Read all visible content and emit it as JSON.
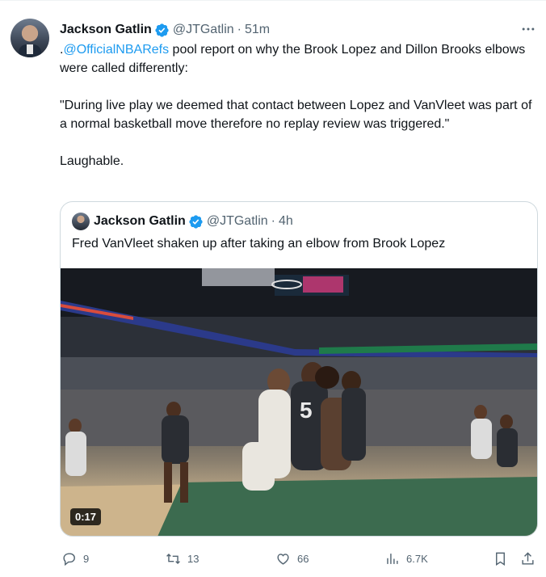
{
  "tweet": {
    "author_name": "Jackson Gatlin",
    "handle": "@JTGatlin",
    "separator": "·",
    "time": "51m",
    "more_icon": "more-icon",
    "text_mention": "@OfficialNBARefs",
    "text_lead": ".",
    "text_rest": " pool report on why the Brook Lopez and Dillon Brooks elbows were called differently:",
    "quote_text": "\"During live play we deemed  that contact between Lopez and VanVleet was part of a normal basketball move therefore no replay review was triggered.\"",
    "closing": "Laughable."
  },
  "quoted": {
    "author_name": "Jackson Gatlin",
    "handle": "@JTGatlin",
    "separator": "·",
    "time": "4h",
    "text": "Fred VanVleet shaken up after taking an elbow from Brook Lopez",
    "video_duration": "0:17"
  },
  "actions": {
    "reply_count": "9",
    "retweet_count": "13",
    "like_count": "66",
    "views_count": "6.7K"
  },
  "colors": {
    "link": "#1d9bf0",
    "verified": "#1d9bf0",
    "secondary_text": "#536471"
  }
}
